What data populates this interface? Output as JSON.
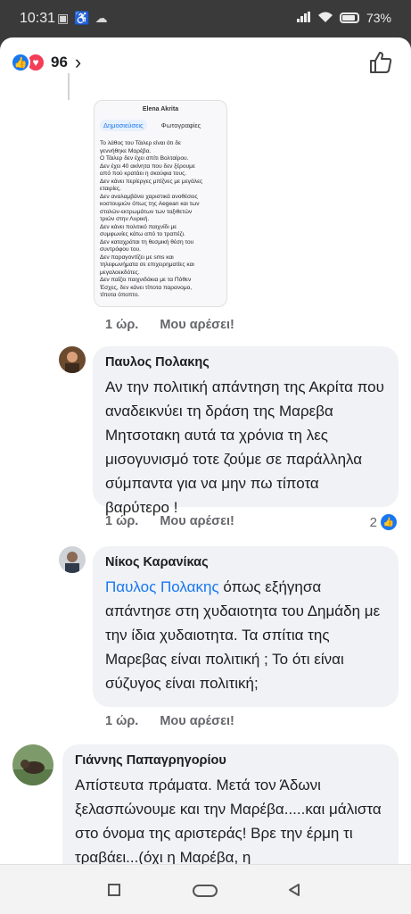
{
  "status_bar": {
    "time": "10:31",
    "left_icons": [
      "gallery-icon",
      "accessibility-icon",
      "cloud-icon"
    ],
    "battery": "73%"
  },
  "header": {
    "reaction_icons": [
      "like",
      "love"
    ],
    "reaction_count": "96"
  },
  "embedded_screenshot": {
    "title": "Elena Akrita",
    "tabs": [
      "Δημοσιεύσεις",
      "Φωτογραφίες"
    ],
    "lines": [
      "Το λάθος του Τάιλερ είναι ότι δε",
      "γεννήθηκε Μαρέβα.",
      "Ο Τάιλερ δεν έχει σπίτι Βολταίρου.",
      "Δεν έχει 40 ακίνητα που δεν ξέρουμε",
      "από πού κρατάει η σκούφια τους.",
      "Δεν κάνει περίεργες μπίζνες με μεγάλες",
      "εταιρίες.",
      "Δεν αναλαμβάνει χαριστικά ανοθέσεις",
      "κοστουμιών όπως της Aegean και των",
      "στολών-εκτρωμάτων των ταξιθετών",
      "τριών στην Λυρική.",
      "Δεν κάνει πολιτικό παιχνίδι με",
      "συμφωνίες κάτω από το τραπέζι.",
      "Δεν καταχράται τη θεσμική θέση του",
      "συντρόφου του.",
      "Δεν παραγοντίζει με sms και",
      "τηλεφωνήματα σε επιχειρηματίες και",
      "μεγαλοεκδότες.",
      "Δεν παίζει παιχνιδάκια με τα Πόθεν",
      "Έσχες, δεν κάνει τίποτα παρανομο,",
      "τίποτα όποπτο."
    ]
  },
  "post_meta": {
    "time": "1 ώρ.",
    "like_label": "Μου αρέσει!"
  },
  "comments": [
    {
      "author": "Παυλος Πολακης",
      "text": "Αν την πολιτική απάντηση της Ακρίτα  που αναδεικνύει τη δράση της Μαρεβα Μητσοτακη αυτά τα χρόνια τη λες  μισογυνισμό τοτε ζούμε σε παράλληλα σύμπαντα για να μην πω τίποτα βαρύτερο !",
      "time": "1 ώρ.",
      "like_label": "Μου αρέσει!",
      "reaction_count": "2"
    },
    {
      "author": "Νίκος Καρανίκας",
      "mention": "Παυλος Πολακης",
      "text": " όπως εξήγησα απάντησε στη χυδαιοτητα του Δημάδη με την ίδια  χυδαιοτητα. Τα σπίτια της Μαρεβας  είναι πολιτική ; Το ότι είναι σύζυγος είναι πολιτική;",
      "time": "1 ώρ.",
      "like_label": "Μου αρέσει!"
    },
    {
      "author": "Γιάννης Παπαγρηγορίου",
      "text": "Απίστευτα πράματα. Μετά τον Άδωνι ξελασπώνουμε και την Μαρέβα.....και μάλιστα στο όνομα της αριστεράς! Βρε την έρμη τι τραβάει...(όχι η Μαρέβα, η"
    }
  ],
  "nav": [
    "recents-square-icon",
    "home-pill-icon",
    "back-triangle-icon"
  ],
  "colors": {
    "accent": "#1877f2",
    "love": "#f33e58",
    "bubble": "#f0f2f5",
    "meta_text": "#65676b"
  }
}
